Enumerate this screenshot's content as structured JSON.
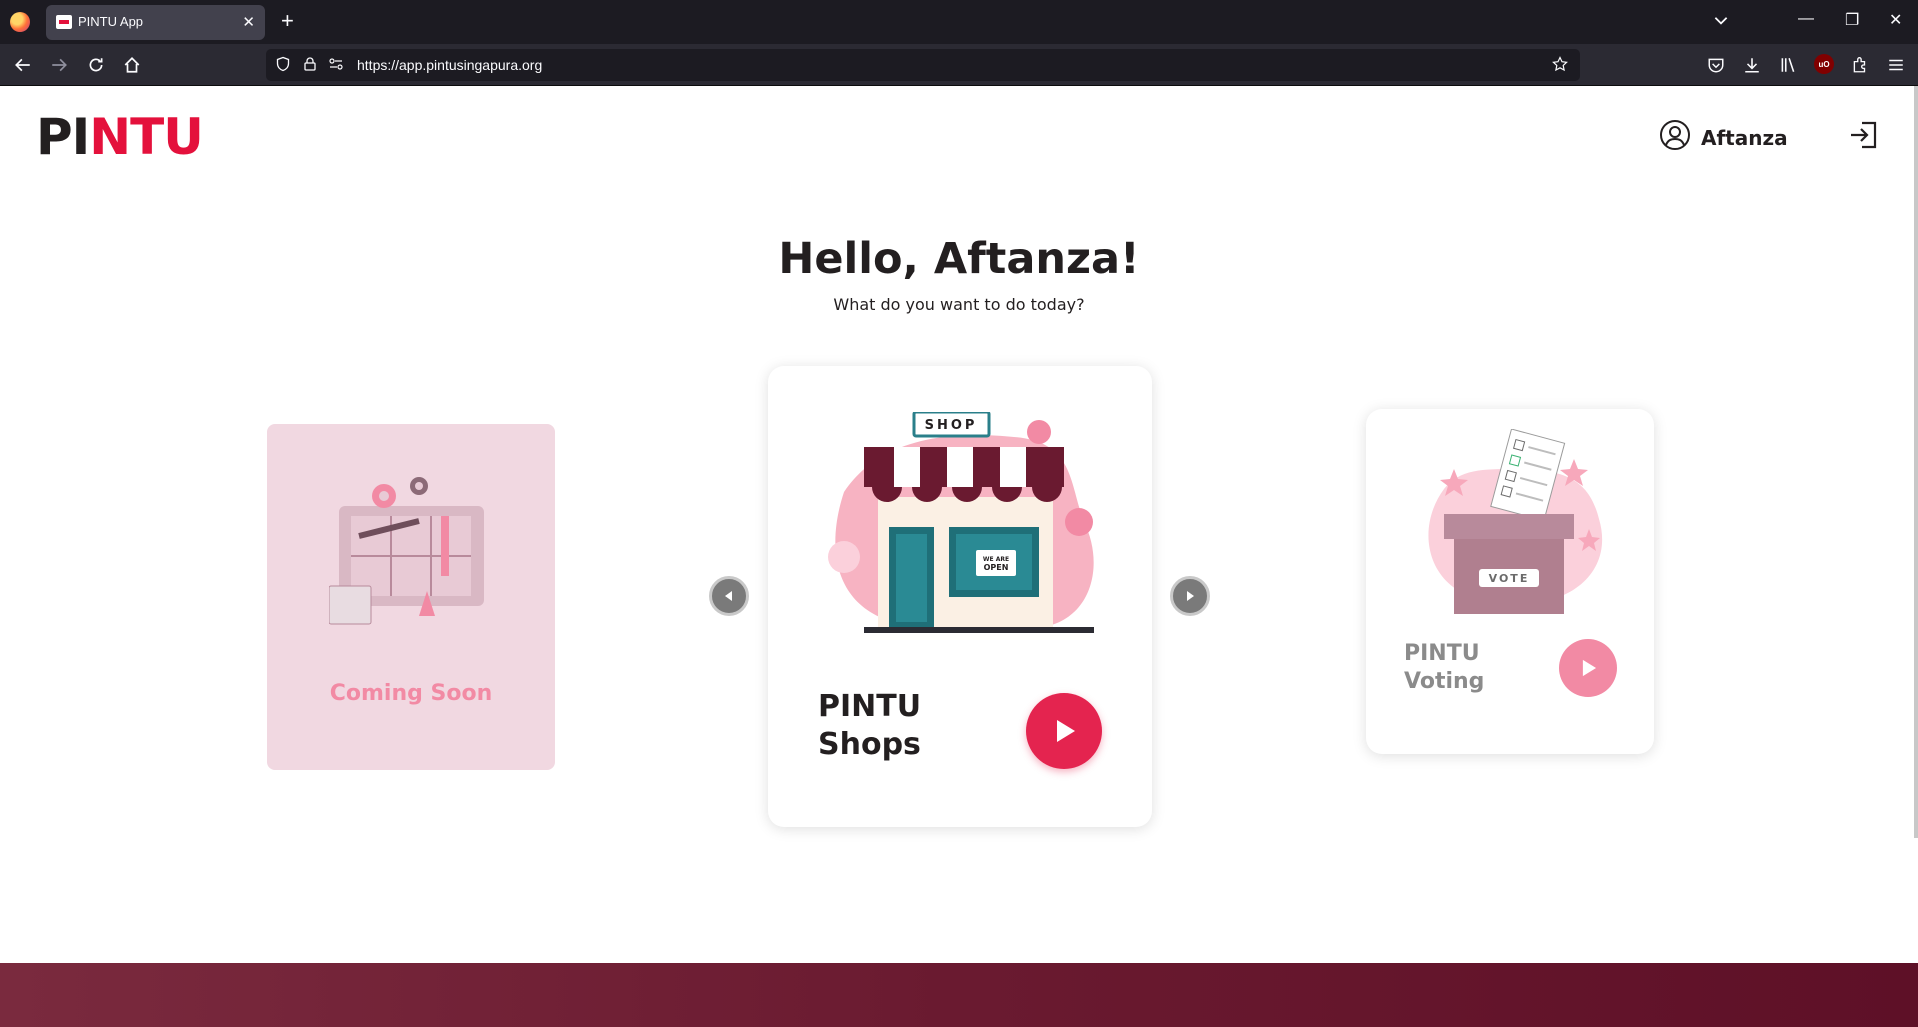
{
  "browser": {
    "tab_title": "PINTU App",
    "url": "https://app.pintusingapura.org"
  },
  "header": {
    "logo_dark": "PI",
    "logo_red": "NTU",
    "username": "Aftanza"
  },
  "main": {
    "greeting": "Hello, Aftanza!",
    "subtitle": "What do you want to do today?"
  },
  "carousel": {
    "left_card_label": "Coming Soon",
    "center_card": {
      "line1": "PINTU",
      "line2": "Shops",
      "sign": "SHOP",
      "door_sign_top": "WE ARE",
      "door_sign_bottom": "OPEN"
    },
    "right_card": {
      "line1": "PINTU",
      "line2": "Voting",
      "box_label": "VOTE"
    }
  },
  "colors": {
    "brand_red": "#e4113c",
    "footer": "#6a1a30",
    "coming_soon_bg": "#f1d8e1"
  },
  "icons": [
    "firefox-icon",
    "close-icon",
    "plus-icon",
    "chevron-down-icon",
    "back-icon",
    "forward-icon",
    "reload-icon",
    "home-icon",
    "shield-icon",
    "lock-icon",
    "permissions-icon",
    "star-icon",
    "pocket-icon",
    "download-icon",
    "library-icon",
    "ublock-icon",
    "extensions-icon",
    "menu-icon",
    "user-icon",
    "logout-icon",
    "play-icon",
    "arrow-left-icon",
    "arrow-right-icon"
  ]
}
